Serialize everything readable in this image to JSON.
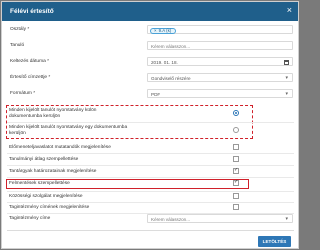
{
  "dialog": {
    "title": "Félévi értesítő",
    "close_glyph": "×"
  },
  "form": {
    "osztaly": {
      "label": "Osztály *",
      "tag_value": "9.A (k)",
      "tag_remove_glyph": "×"
    },
    "tanulo": {
      "label": "Tanuló",
      "placeholder": "Kérem válasszon..."
    },
    "keltezes": {
      "label": "Keltezés dátuma *",
      "value": "2019. 01. 18."
    },
    "ertesito_cimzettje": {
      "label": "Értesítő címzettje *",
      "value": "Gondviselő részére"
    },
    "formatum": {
      "label": "Formátum *",
      "value": "PDF"
    },
    "nyomtatvany_kulon": {
      "label_line1": "Minden kijelölt tanulót nyomtatvány külön",
      "label_line2": "dokumentumba kerüljön",
      "checked": true
    },
    "nyomtatvany_egy": {
      "label_line1": "Minden kijelölt tanulót nyomtatvány egy dokumentumba",
      "label_line2": "kerüljön",
      "checked": false
    },
    "checkboxes": [
      {
        "label": "Előmeneteljavaslatot mutatandók megjelenítése",
        "checked": false
      },
      {
        "label": "Tanulmányi átlag szempellettése",
        "checked": false
      },
      {
        "label": "Tantárgyak határozatainak megjelenítése",
        "checked": true
      },
      {
        "label": "Felmentések szempellettése",
        "checked": true
      },
      {
        "label": "Közösségi szolgálat megjelenítése",
        "checked": false
      },
      {
        "label": "Tagintézmény címének megjelenítése",
        "checked": false
      }
    ],
    "tagintezmeny_cime": {
      "label": "Tagintézmény címe",
      "placeholder": "Kérem válasszon..."
    }
  },
  "footer": {
    "download_label": "LETÖLTÉS"
  },
  "icons": {
    "caret": "▾"
  },
  "colors": {
    "titlebar": "#1f5f8b",
    "highlight": "#d0202a",
    "button": "#2e77b6"
  }
}
